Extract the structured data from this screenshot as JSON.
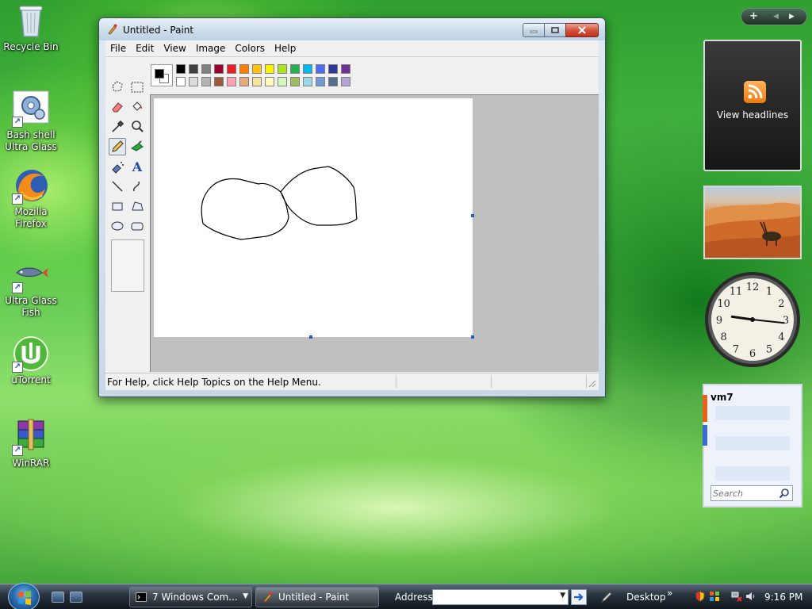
{
  "desktop": {
    "icons": [
      {
        "label_line1": "Recycle Bin",
        "label_line2": ""
      },
      {
        "label_line1": "Bash shell",
        "label_line2": "Ultra Glass"
      },
      {
        "label_line1": "Mozilla",
        "label_line2": "Firefox"
      },
      {
        "label_line1": "Ultra Glass",
        "label_line2": "Fish"
      },
      {
        "label_line1": "uTorrent",
        "label_line2": ""
      },
      {
        "label_line1": "WinRAR",
        "label_line2": ""
      }
    ]
  },
  "paint": {
    "title": "Untitled - Paint",
    "menu": [
      "File",
      "Edit",
      "View",
      "Image",
      "Colors",
      "Help"
    ],
    "tools": [
      "free-form-select-icon",
      "select-icon",
      "eraser-icon",
      "fill-icon",
      "color-picker-icon",
      "magnifier-icon",
      "pencil-icon",
      "brush-icon",
      "airbrush-icon",
      "text-icon",
      "line-icon",
      "curve-icon",
      "rectangle-icon",
      "polygon-icon",
      "ellipse-icon",
      "rounded-rectangle-icon"
    ],
    "active_tool": "pencil-icon",
    "foreground_color": "#000000",
    "background_color": "#ffffff",
    "palette_top": [
      "#000000",
      "#404040",
      "#808080",
      "#990030",
      "#ed1c24",
      "#ff7e00",
      "#ffc20e",
      "#fff200",
      "#a8e61d",
      "#22b14c",
      "#00b7ef",
      "#4d6df3",
      "#2f3699",
      "#6f3198"
    ],
    "palette_bottom": [
      "#ffffff",
      "#dcdcdc",
      "#b4b4b4",
      "#9c5a3c",
      "#ffa3b1",
      "#e5aa7a",
      "#f5e49c",
      "#fff9bd",
      "#d3f9bc",
      "#9dbb61",
      "#99d9ea",
      "#709ad1",
      "#546d8e",
      "#b5a5d5"
    ],
    "status_text": "For Help, click Help Topics on the Help Menu."
  },
  "sidebar": {
    "top_controls": [
      "+",
      "◀",
      "▶"
    ],
    "feed_label": "View headlines",
    "clock_numbers": [
      "12",
      "1",
      "2",
      "3",
      "4",
      "5",
      "6",
      "7",
      "8",
      "9",
      "10",
      "11"
    ],
    "clock_time": {
      "hour": 9,
      "minute": 16
    },
    "notes_title": "vm7",
    "search_placeholder": "Search"
  },
  "taskbar": {
    "tasks": [
      {
        "label": "7 Windows Com..."
      },
      {
        "label": "Untitled - Paint"
      }
    ],
    "address_label": "Address",
    "address_value": "",
    "desktop_label": "Desktop",
    "chevron": "»",
    "clock": "9:16 PM"
  }
}
